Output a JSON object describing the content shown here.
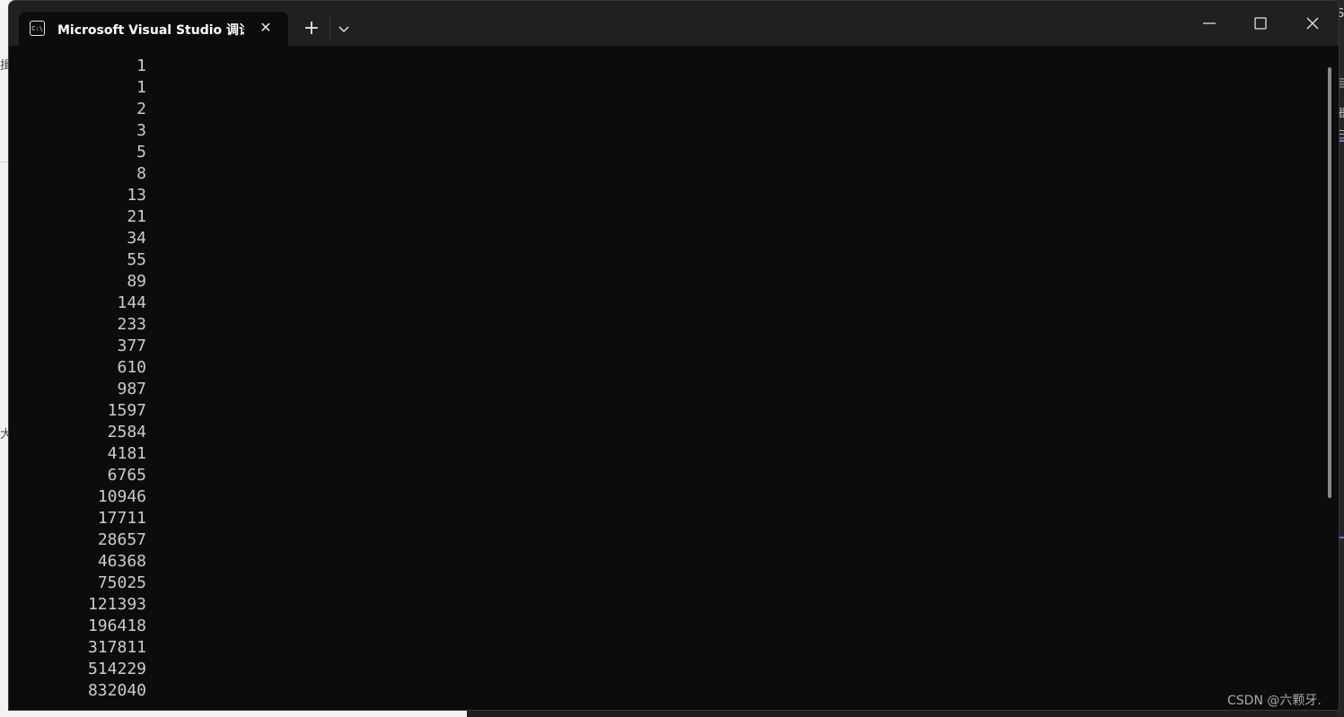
{
  "window": {
    "tab_title": "Microsoft Visual Studio 调试控",
    "tab_icon_text": "C:\\",
    "new_tab_label": "+",
    "close_tab_label": "✕"
  },
  "console": {
    "lines": [
      "1",
      "1",
      "2",
      "3",
      "5",
      "8",
      "13",
      "21",
      "34",
      "55",
      "89",
      "144",
      "233",
      "377",
      "610",
      "987",
      "1597",
      "2584",
      "4181",
      "6765",
      "10946",
      "17711",
      "28657",
      "46368",
      "75025",
      "121393",
      "196418",
      "317811",
      "514229",
      "832040"
    ]
  },
  "background": {
    "left_chars": [
      "揖",
      "大"
    ],
    "right_top_char": "S",
    "right_chars": [
      "目",
      "器",
      "三"
    ]
  },
  "watermark": "CSDN @六颗牙."
}
